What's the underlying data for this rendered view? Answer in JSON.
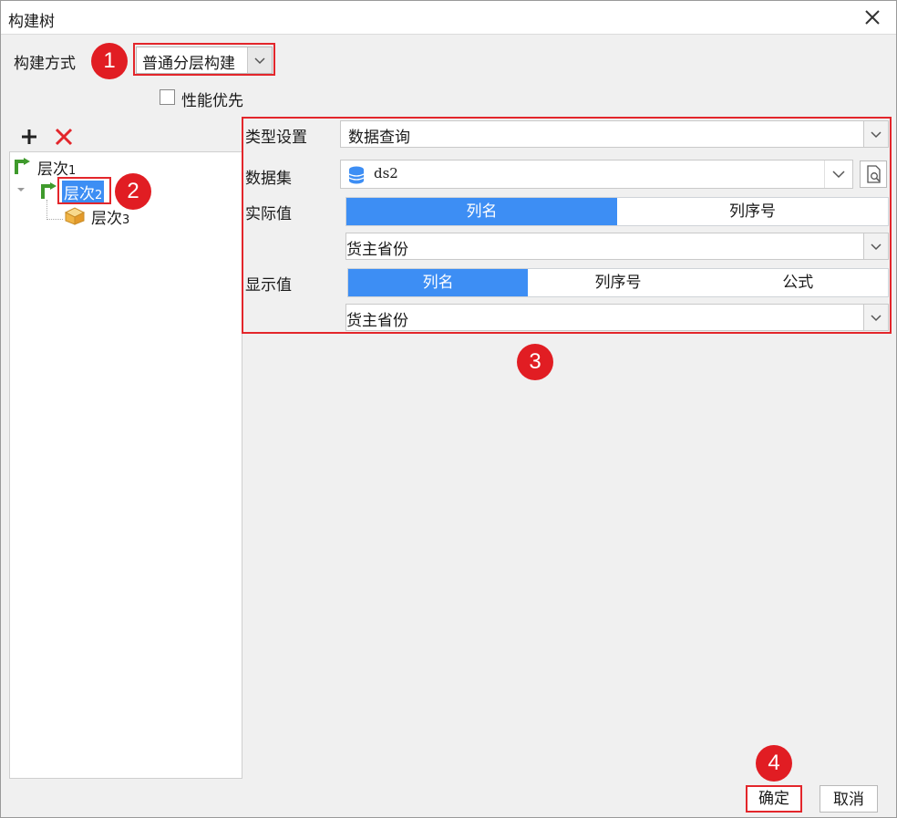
{
  "window": {
    "title": "构建树"
  },
  "build_mode": {
    "label": "构建方式",
    "value": "普通分层构建"
  },
  "performance_first": {
    "label": "性能优先",
    "checked": false
  },
  "tree": {
    "nodes": [
      {
        "label": "层次",
        "index": "1"
      },
      {
        "label": "层次",
        "index": "2"
      },
      {
        "label": "层次",
        "index": "3"
      }
    ]
  },
  "settings": {
    "type_label": "类型设置",
    "type_value": "数据查询",
    "dataset_label": "数据集",
    "dataset_value": "ds2",
    "actual_label": "实际值",
    "actual_tabs": [
      "列名",
      "列序号"
    ],
    "actual_field": "货主省份",
    "display_label": "显示值",
    "display_tabs": [
      "列名",
      "列序号",
      "公式"
    ],
    "display_field": "货主省份"
  },
  "buttons": {
    "ok": "确定",
    "cancel": "取消"
  },
  "badges": [
    "1",
    "2",
    "3",
    "4"
  ],
  "colors": {
    "accent": "#3d8ef4",
    "annotation": "#e11d23"
  }
}
